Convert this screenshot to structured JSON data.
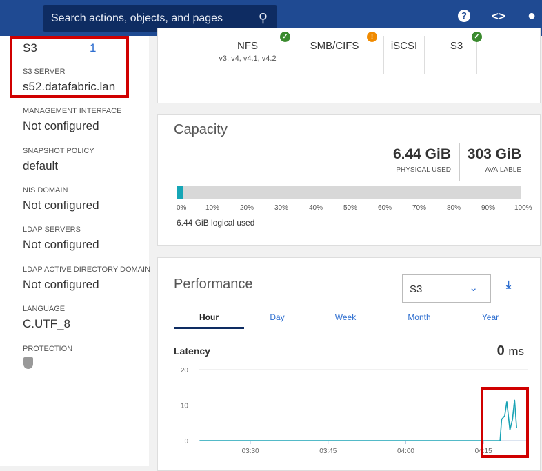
{
  "header": {
    "search_placeholder": "Search actions, objects, and pages",
    "icons": [
      "search-icon",
      "help-icon",
      "code-icon",
      "user-icon"
    ]
  },
  "left": {
    "s3_label": "S3",
    "s3_count": "1",
    "fields": [
      {
        "label": "S3 SERVER",
        "value": "s52.datafabric.lan"
      },
      {
        "label": "MANAGEMENT INTERFACE",
        "value": "Not configured"
      },
      {
        "label": "SNAPSHOT POLICY",
        "value": "default"
      },
      {
        "label": "NIS DOMAIN",
        "value": "Not configured"
      },
      {
        "label": "LDAP SERVERS",
        "value": "Not configured"
      },
      {
        "label": "LDAP ACTIVE DIRECTORY DOMAIN",
        "value": "Not configured"
      },
      {
        "label": "LANGUAGE",
        "value": "C.UTF_8"
      },
      {
        "label": "PROTECTION",
        "value": ""
      }
    ]
  },
  "protocols": [
    {
      "name": "NFS",
      "sub": "v3, v4, v4.1, v4.2",
      "status": "ok"
    },
    {
      "name": "SMB/CIFS",
      "status": "warning"
    },
    {
      "name": "iSCSI"
    },
    {
      "name": "S3",
      "status": "ok"
    }
  ],
  "capacity": {
    "title": "Capacity",
    "physical_used": "6.44 GiB",
    "physical_used_label": "PHYSICAL USED",
    "available": "303 GiB",
    "available_label": "AVAILABLE",
    "used_percent": 2,
    "ticks": [
      "0%",
      "10%",
      "20%",
      "30%",
      "40%",
      "50%",
      "60%",
      "70%",
      "80%",
      "90%",
      "100%"
    ],
    "logical_used": "6.44 GiB logical used"
  },
  "performance": {
    "title": "Performance",
    "select_value": "S3",
    "tabs": [
      "Hour",
      "Day",
      "Week",
      "Month",
      "Year"
    ],
    "active_tab": "Hour",
    "metric": "Latency",
    "metric_value": "0",
    "metric_unit": "ms"
  },
  "chart_data": {
    "type": "line",
    "title": "Latency",
    "ylabel": "ms",
    "ylim": [
      0,
      20
    ],
    "yticks": [
      "20",
      "10",
      "0"
    ],
    "xticks": [
      "03:30",
      "03:45",
      "04:00",
      "04:15"
    ],
    "x_unit": "minutes after 03:00",
    "xlim": [
      20,
      83.5
    ],
    "series": [
      {
        "name": "S3 latency",
        "color": "#1aa3b5",
        "x": [
          20.2,
          78.2,
          78.5,
          79.1,
          79.5,
          80.1,
          80.6,
          81.0,
          81.4
        ],
        "y": [
          0,
          0,
          6,
          7,
          11,
          3,
          6,
          11.5,
          3.5
        ]
      }
    ]
  }
}
